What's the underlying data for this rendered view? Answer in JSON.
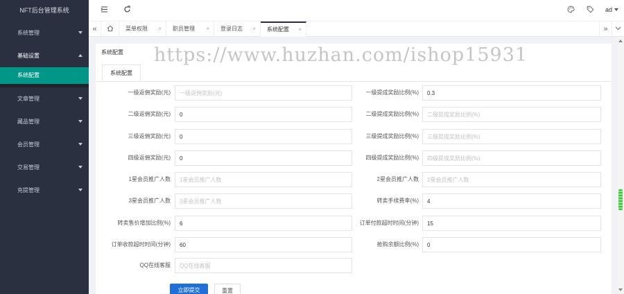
{
  "app": {
    "title": "NFT后台管理系统"
  },
  "sidebar": {
    "items": [
      {
        "label": "系统管理",
        "open": false
      },
      {
        "label": "基础设置",
        "open": true,
        "children": [
          {
            "label": "系统配置",
            "active": true
          }
        ]
      },
      {
        "label": "文章管理",
        "open": false
      },
      {
        "label": "藏品管理",
        "open": false
      },
      {
        "label": "会员管理",
        "open": false
      },
      {
        "label": "交易管理",
        "open": false
      },
      {
        "label": "充提管理",
        "open": false
      }
    ]
  },
  "header": {
    "user": "ad",
    "icons": [
      "menu-fold-icon",
      "refresh-icon",
      "theme-icon",
      "tag-icon"
    ]
  },
  "tabs": [
    {
      "label": "菜单权限"
    },
    {
      "label": "职员管理"
    },
    {
      "label": "登录日志"
    },
    {
      "label": "系统配置",
      "active": true
    }
  ],
  "panel": {
    "title": "系统配置",
    "inner_tab": "系统配置"
  },
  "form": {
    "left": [
      {
        "label": "一级返佣奖励(元)",
        "value": "",
        "placeholder": "一级返佣奖励(元)"
      },
      {
        "label": "二级返佣奖励(元)",
        "value": "0",
        "placeholder": ""
      },
      {
        "label": "三级返佣奖励(元)",
        "value": "0",
        "placeholder": ""
      },
      {
        "label": "四级返佣奖励(元)",
        "value": "0",
        "placeholder": ""
      },
      {
        "label": "1星会员推广人数",
        "value": "",
        "placeholder": "1星会员推广人数"
      },
      {
        "label": "3星会员推广人数",
        "value": "",
        "placeholder": "3星会员推广人数"
      },
      {
        "label": "转卖售价增加比例(%)",
        "value": "6",
        "placeholder": ""
      },
      {
        "label": "订单收款超时时间(分钟)",
        "value": "60",
        "placeholder": ""
      },
      {
        "label": "QQ在线客服",
        "value": "",
        "placeholder": "QQ在线客服"
      }
    ],
    "right": [
      {
        "label": "一级提成奖励比例(%)",
        "value": "0.3",
        "placeholder": ""
      },
      {
        "label": "二级提成奖励比例(%)",
        "value": "",
        "placeholder": "二级提成奖励比例(%)"
      },
      {
        "label": "三级提成奖励比例(%)",
        "value": "",
        "placeholder": "三级提成奖励比例(%)"
      },
      {
        "label": "四级提成奖励比例(%)",
        "value": "",
        "placeholder": "四级提成奖励比例(%)"
      },
      {
        "label": "2星会员推广人数",
        "value": "",
        "placeholder": "2星会员推广人数"
      },
      {
        "label": "转卖手续费率(%)",
        "value": "4",
        "placeholder": ""
      },
      {
        "label": "订单付款超时时间(分钟)",
        "value": "15",
        "placeholder": ""
      },
      {
        "label": "抢购余额比例(%)",
        "value": "0",
        "placeholder": ""
      }
    ],
    "submit_label": "立即提交",
    "reset_label": "重置"
  },
  "watermark": "https://www.huzhan.com/ishop15931"
}
